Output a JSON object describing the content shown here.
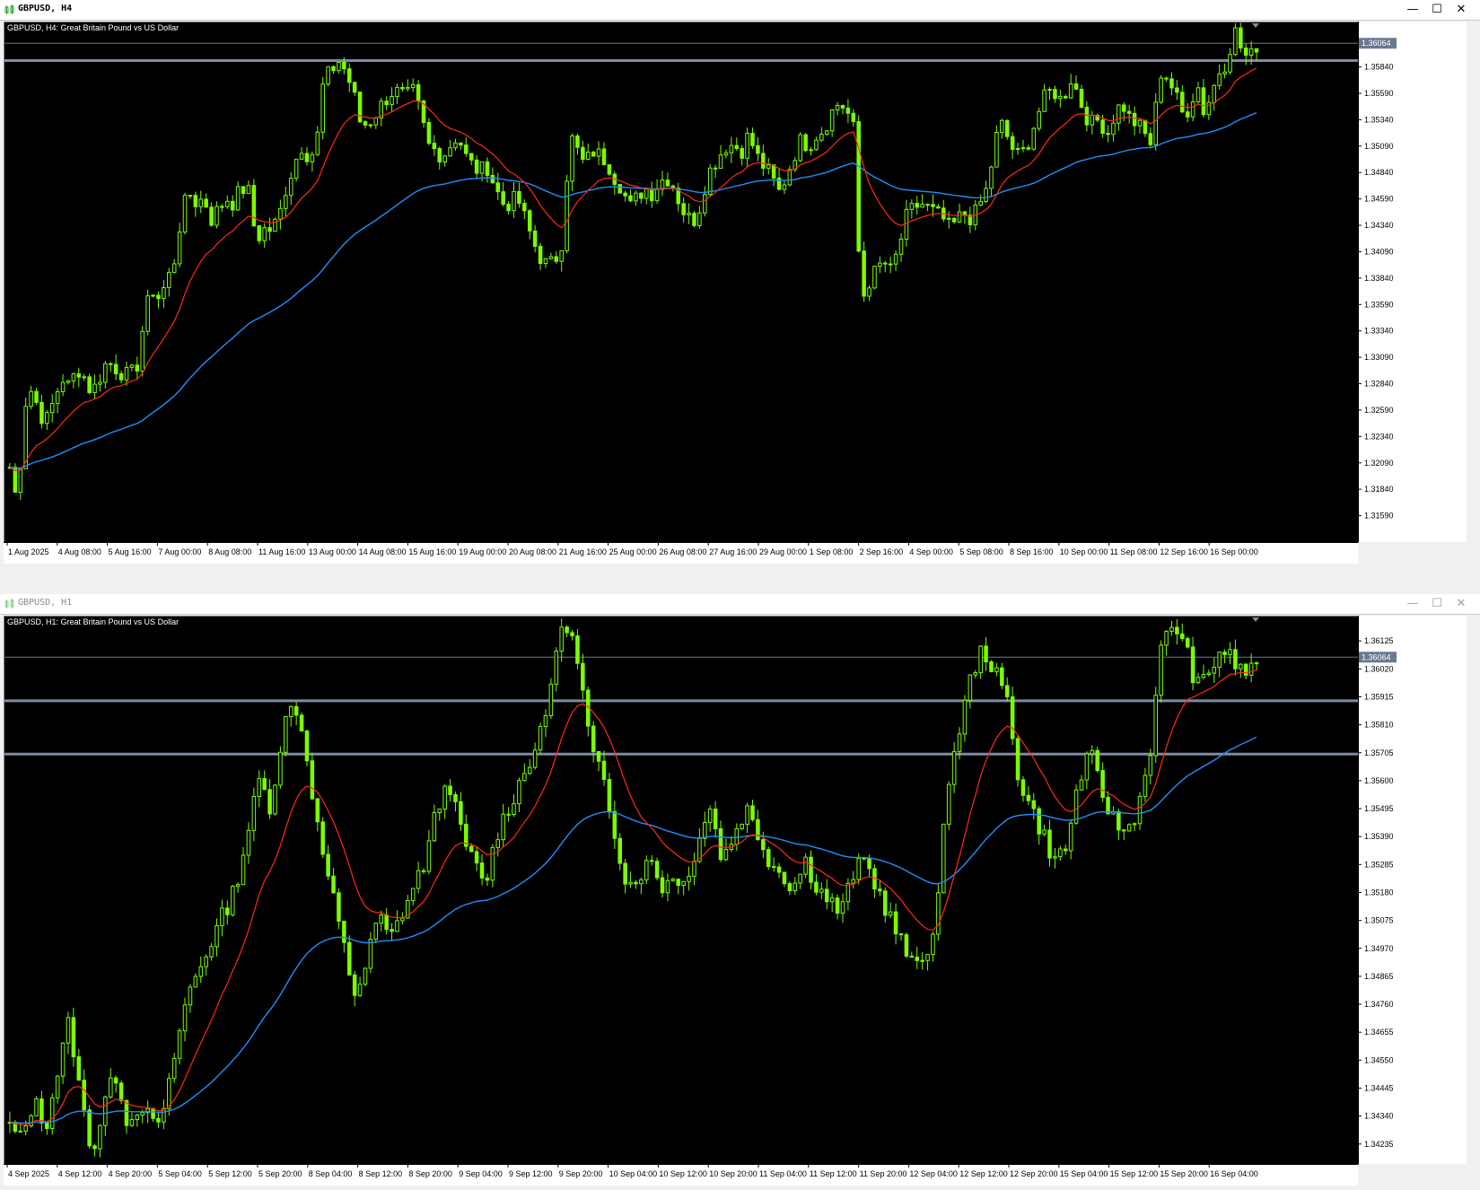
{
  "windows": [
    {
      "title": "GBPUSD, H4",
      "active": true,
      "buttons": {
        "minimize": "—",
        "maximize": "☐",
        "close": "✕"
      },
      "chart_data": {
        "type": "candlestick",
        "symbol_label": "GBPUSD, H4:  Great Britain Pound vs US Dollar",
        "ylim": [
          1.3134,
          1.3627
        ],
        "y_ticks": [
          "1.35840",
          "1.35590",
          "1.35340",
          "1.35090",
          "1.34840",
          "1.34590",
          "1.34340",
          "1.34090",
          "1.33840",
          "1.33590",
          "1.33340",
          "1.33090",
          "1.32840",
          "1.32590",
          "1.32340",
          "1.32090",
          "1.31840",
          "1.31590"
        ],
        "x_ticks": [
          "1 Aug 2025",
          "4 Aug 08:00",
          "5 Aug 16:00",
          "7 Aug 00:00",
          "8 Aug 08:00",
          "11 Aug 16:00",
          "13 Aug 00:00",
          "14 Aug 08:00",
          "15 Aug 16:00",
          "19 Aug 00:00",
          "20 Aug 08:00",
          "21 Aug 16:00",
          "25 Aug 00:00",
          "26 Aug 08:00",
          "27 Aug 16:00",
          "29 Aug 00:00",
          "1 Sep 08:00",
          "2 Sep 16:00",
          "4 Sep 00:00",
          "5 Sep 08:00",
          "8 Sep 16:00",
          "10 Sep 00:00",
          "11 Sep 08:00",
          "12 Sep 16:00",
          "16 Sep 00:00"
        ],
        "price_label": "1.36064",
        "current_price": 1.36064,
        "hlines": [
          1.359
        ],
        "candle_count": 236,
        "closes": [
          1.3205,
          1.317,
          1.3265,
          1.328,
          1.3255,
          1.325,
          1.327,
          1.329,
          1.328,
          1.33,
          1.329,
          1.3275,
          1.329,
          1.3305,
          1.33,
          1.3295,
          1.329,
          1.33,
          1.3345,
          1.3375,
          1.3365,
          1.338,
          1.34,
          1.3445,
          1.3465,
          1.3455,
          1.346,
          1.344,
          1.345,
          1.346,
          1.3455,
          1.347,
          1.3465,
          1.342,
          1.343,
          1.343,
          1.344,
          1.347,
          1.349,
          1.351,
          1.35,
          1.3505,
          1.357,
          1.358,
          1.359,
          1.358,
          1.356,
          1.353,
          1.353,
          1.354,
          1.355,
          1.356,
          1.356,
          1.3555,
          1.356,
          1.354,
          1.351,
          1.3505,
          1.35,
          1.351,
          1.352,
          1.35,
          1.349,
          1.3485,
          1.349,
          1.347,
          1.3455,
          1.3455,
          1.346,
          1.344,
          1.342,
          1.3405,
          1.3395,
          1.34,
          1.342,
          1.352,
          1.3505,
          1.349,
          1.3505,
          1.35,
          1.3495,
          1.348,
          1.347,
          1.345,
          1.346,
          1.347,
          1.3465,
          1.3475,
          1.348,
          1.347,
          1.345,
          1.344,
          1.344,
          1.347,
          1.349,
          1.35,
          1.351,
          1.351,
          1.3505,
          1.352,
          1.35,
          1.349,
          1.348,
          1.3465,
          1.348,
          1.35,
          1.3515,
          1.351,
          1.352,
          1.3525,
          1.354,
          1.355,
          1.3545,
          1.3525,
          1.336,
          1.338,
          1.339,
          1.34,
          1.339,
          1.341,
          1.344,
          1.345,
          1.3455,
          1.345,
          1.3445,
          1.344,
          1.343,
          1.344,
          1.3445,
          1.344,
          1.3455,
          1.347,
          1.3515,
          1.353,
          1.351,
          1.35,
          1.3505,
          1.3525,
          1.3545,
          1.356,
          1.356,
          1.355,
          1.3575,
          1.356,
          1.354,
          1.353,
          1.3535,
          1.352,
          1.354,
          1.355,
          1.3535,
          1.353,
          1.352,
          1.351,
          1.358,
          1.3575,
          1.356,
          1.354,
          1.3545,
          1.357,
          1.354,
          1.356,
          1.358,
          1.359,
          1.362,
          1.36,
          1.359,
          1.3605
        ],
        "fast_ma_color": "#ff2a1a",
        "slow_ma_color": "#1e90ff",
        "candle_color": "#7cfc00",
        "grid": false,
        "background": "#000000"
      }
    },
    {
      "title": "GBPUSD, H1",
      "active": false,
      "buttons": {
        "minimize": "—",
        "maximize": "☐",
        "close": "✕"
      },
      "chart_data": {
        "type": "candlestick",
        "symbol_label": "GBPUSD, H1:  Great Britain Pound vs US Dollar",
        "ylim": [
          1.3416,
          1.3622
        ],
        "y_ticks": [
          "1.36125",
          "1.36020",
          "1.35915",
          "1.35810",
          "1.35705",
          "1.35600",
          "1.35495",
          "1.35390",
          "1.35285",
          "1.35180",
          "1.35075",
          "1.34970",
          "1.34865",
          "1.34760",
          "1.34655",
          "1.34550",
          "1.34445",
          "1.34340",
          "1.34235"
        ],
        "x_ticks": [
          "4 Sep 2025",
          "4 Sep 12:00",
          "4 Sep 20:00",
          "5 Sep 04:00",
          "5 Sep 12:00",
          "5 Sep 20:00",
          "8 Sep 04:00",
          "8 Sep 12:00",
          "8 Sep 20:00",
          "9 Sep 04:00",
          "9 Sep 12:00",
          "9 Sep 20:00",
          "10 Sep 04:00",
          "10 Sep 12:00",
          "10 Sep 20:00",
          "11 Sep 04:00",
          "11 Sep 12:00",
          "11 Sep 20:00",
          "12 Sep 04:00",
          "12 Sep 12:00",
          "12 Sep 20:00",
          "15 Sep 04:00",
          "15 Sep 12:00",
          "15 Sep 20:00",
          "16 Sep 04:00"
        ],
        "price_label": "1.36064",
        "current_price": 1.36064,
        "hlines": [
          1.359,
          1.357
        ],
        "candle_count": 236,
        "closes": [
          1.343,
          1.3425,
          1.344,
          1.343,
          1.345,
          1.347,
          1.344,
          1.342,
          1.344,
          1.345,
          1.343,
          1.344,
          1.343,
          1.3435,
          1.346,
          1.348,
          1.349,
          1.35,
          1.351,
          1.352,
          1.354,
          1.356,
          1.355,
          1.358,
          1.359,
          1.357,
          1.354,
          1.352,
          1.35,
          1.348,
          1.349,
          1.351,
          1.35,
          1.351,
          1.352,
          1.353,
          1.355,
          1.356,
          1.354,
          1.353,
          1.352,
          1.354,
          1.355,
          1.356,
          1.357,
          1.358,
          1.361,
          1.362,
          1.36,
          1.357,
          1.356,
          1.354,
          1.352,
          1.3525,
          1.353,
          1.352,
          1.3525,
          1.352,
          1.354,
          1.355,
          1.353,
          1.354,
          1.355,
          1.354,
          1.353,
          1.3525,
          1.352,
          1.353,
          1.352,
          1.3515,
          1.351,
          1.3525,
          1.353,
          1.352,
          1.351,
          1.35,
          1.349,
          1.3495,
          1.3505,
          1.356,
          1.358,
          1.36,
          1.361,
          1.36,
          1.359,
          1.356,
          1.355,
          1.354,
          1.353,
          1.3535,
          1.356,
          1.357,
          1.3555,
          1.3545,
          1.354,
          1.355,
          1.357,
          1.361,
          1.362,
          1.361,
          1.3595,
          1.36,
          1.361,
          1.3605,
          1.36,
          1.3606
        ],
        "fast_ma_color": "#ff2a1a",
        "slow_ma_color": "#1e90ff",
        "candle_color": "#7cfc00",
        "grid": false,
        "background": "#000000"
      }
    }
  ]
}
